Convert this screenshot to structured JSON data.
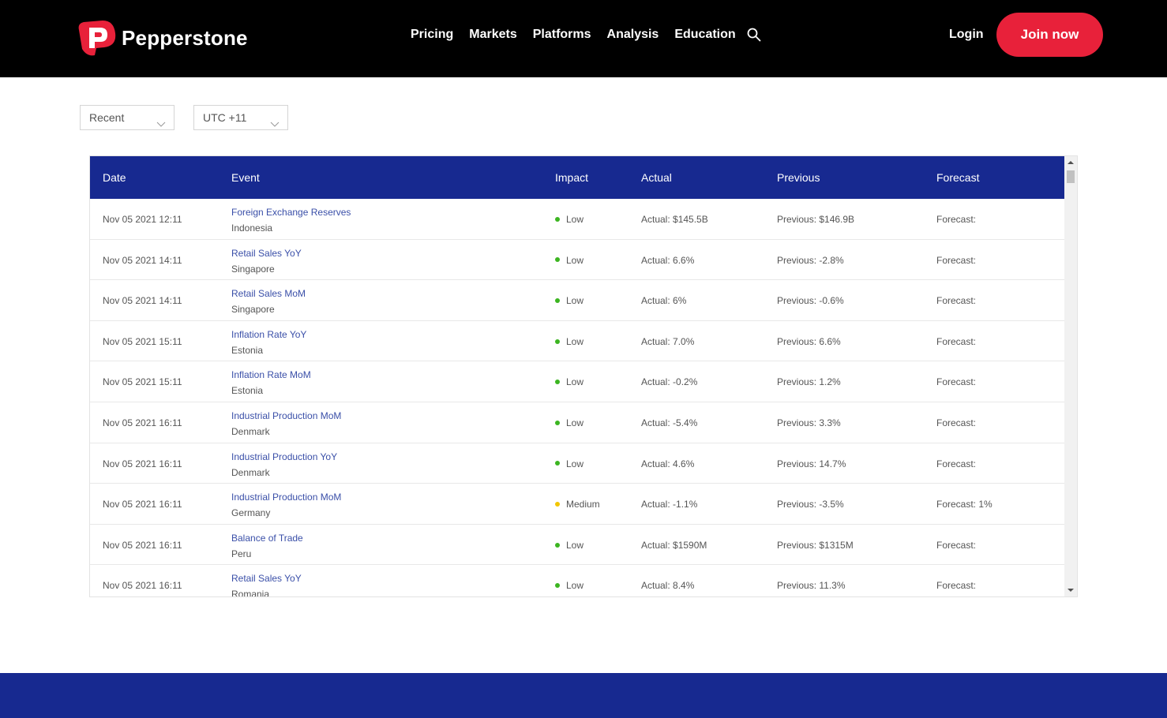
{
  "brand": {
    "name": "Pepperstone",
    "accent": "#e8213a",
    "navy": "#172990"
  },
  "nav": {
    "items": [
      {
        "label": "Pricing"
      },
      {
        "label": "Markets"
      },
      {
        "label": "Platforms"
      },
      {
        "label": "Analysis"
      },
      {
        "label": "Education"
      }
    ],
    "search_icon": "search-icon",
    "login_label": "Login",
    "join_label": "Join now"
  },
  "filters": {
    "range": {
      "value": "Recent"
    },
    "timezone": {
      "value": "UTC +11"
    }
  },
  "table": {
    "headers": {
      "date": "Date",
      "event": "Event",
      "impact": "Impact",
      "actual": "Actual",
      "previous": "Previous",
      "forecast": "Forecast"
    },
    "impact_colors": {
      "Low": "#3cb521",
      "Medium": "#f2c600"
    },
    "rows": [
      {
        "date": "Nov 05 2021 12:11",
        "event": "Foreign Exchange Reserves",
        "country": "Indonesia",
        "impact": "Low",
        "actual": "Actual: $145.5B",
        "previous": "Previous: $146.9B",
        "forecast": "Forecast:"
      },
      {
        "date": "Nov 05 2021 14:11",
        "event": "Retail Sales YoY",
        "country": "Singapore",
        "impact": "Low",
        "actual": "Actual: 6.6%",
        "previous": "Previous: -2.8%",
        "forecast": "Forecast:"
      },
      {
        "date": "Nov 05 2021 14:11",
        "event": "Retail Sales MoM",
        "country": "Singapore",
        "impact": "Low",
        "actual": "Actual: 6%",
        "previous": "Previous: -0.6%",
        "forecast": "Forecast:"
      },
      {
        "date": "Nov 05 2021 15:11",
        "event": "Inflation Rate YoY",
        "country": "Estonia",
        "impact": "Low",
        "actual": "Actual: 7.0%",
        "previous": "Previous: 6.6%",
        "forecast": "Forecast:"
      },
      {
        "date": "Nov 05 2021 15:11",
        "event": "Inflation Rate MoM",
        "country": "Estonia",
        "impact": "Low",
        "actual": "Actual: -0.2%",
        "previous": "Previous: 1.2%",
        "forecast": "Forecast:"
      },
      {
        "date": "Nov 05 2021 16:11",
        "event": "Industrial Production MoM",
        "country": "Denmark",
        "impact": "Low",
        "actual": "Actual: -5.4%",
        "previous": "Previous: 3.3%",
        "forecast": "Forecast:"
      },
      {
        "date": "Nov 05 2021 16:11",
        "event": "Industrial Production YoY",
        "country": "Denmark",
        "impact": "Low",
        "actual": "Actual: 4.6%",
        "previous": "Previous: 14.7%",
        "forecast": "Forecast:"
      },
      {
        "date": "Nov 05 2021 16:11",
        "event": "Industrial Production MoM",
        "country": "Germany",
        "impact": "Medium",
        "actual": "Actual: -1.1%",
        "previous": "Previous: -3.5%",
        "forecast": "Forecast: 1%"
      },
      {
        "date": "Nov 05 2021 16:11",
        "event": "Balance of Trade",
        "country": "Peru",
        "impact": "Low",
        "actual": "Actual: $1590M",
        "previous": "Previous: $1315M",
        "forecast": "Forecast:"
      },
      {
        "date": "Nov 05 2021 16:11",
        "event": "Retail Sales YoY",
        "country": "Romania",
        "impact": "Low",
        "actual": "Actual: 8.4%",
        "previous": "Previous: 11.3%",
        "forecast": "Forecast:"
      }
    ]
  }
}
